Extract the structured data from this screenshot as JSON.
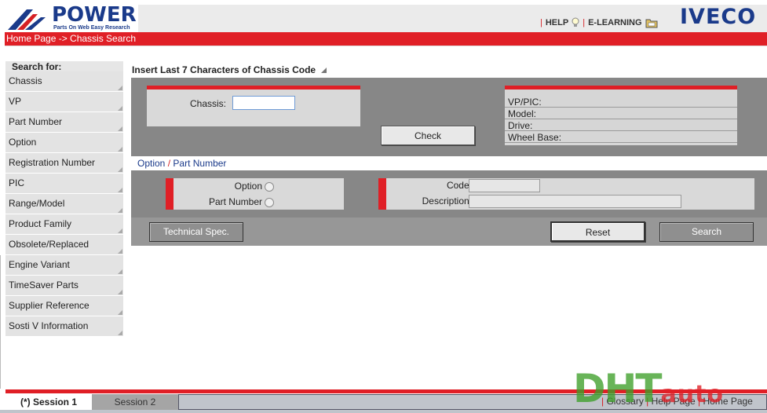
{
  "header": {
    "logo_word": "POWER",
    "logo_tagline": "Parts On Web Easy Research",
    "links": [
      "HELP",
      "E-LEARNING"
    ],
    "brand": "IVECO",
    "breadcrumb": "Home Page -> Chassis Search"
  },
  "sidebar": {
    "heading": "Search for:",
    "items": [
      "Chassis",
      "VP",
      "Part Number",
      "Option",
      "Registration Number",
      "PIC",
      "Range/Model",
      "Product Family",
      "Obsolete/Replaced",
      "Engine Variant",
      "TimeSaver Parts",
      "Supplier Reference",
      "Sosti V Information"
    ]
  },
  "chassis_search": {
    "title": "Insert Last 7 Characters of Chassis Code",
    "chassis_label": "Chassis:",
    "chassis_value": "",
    "check_label": "Check",
    "info_labels": [
      "VP/PIC:",
      "Model:",
      "Drive:",
      "Wheel Base:"
    ]
  },
  "option_search": {
    "link_option": "Option",
    "link_separator": "/",
    "link_part_number": "Part Number",
    "radio_option": "Option",
    "radio_part_number": "Part Number",
    "code_label": "Code:",
    "code_value": "",
    "description_label": "Description:",
    "description_value": ""
  },
  "actions": {
    "technical_spec": "Technical Spec.",
    "reset": "Reset",
    "search": "Search"
  },
  "footer": {
    "tabs": [
      "(*) Session 1",
      "Session 2"
    ],
    "links": [
      "Glossary",
      "Help Page",
      "Home Page"
    ]
  },
  "watermark": {
    "main": "DHT",
    "sub": "auto"
  },
  "colors": {
    "accent_red": "#e01f26",
    "brand_blue": "#1a3a8a",
    "panel_gray": "#878787"
  }
}
